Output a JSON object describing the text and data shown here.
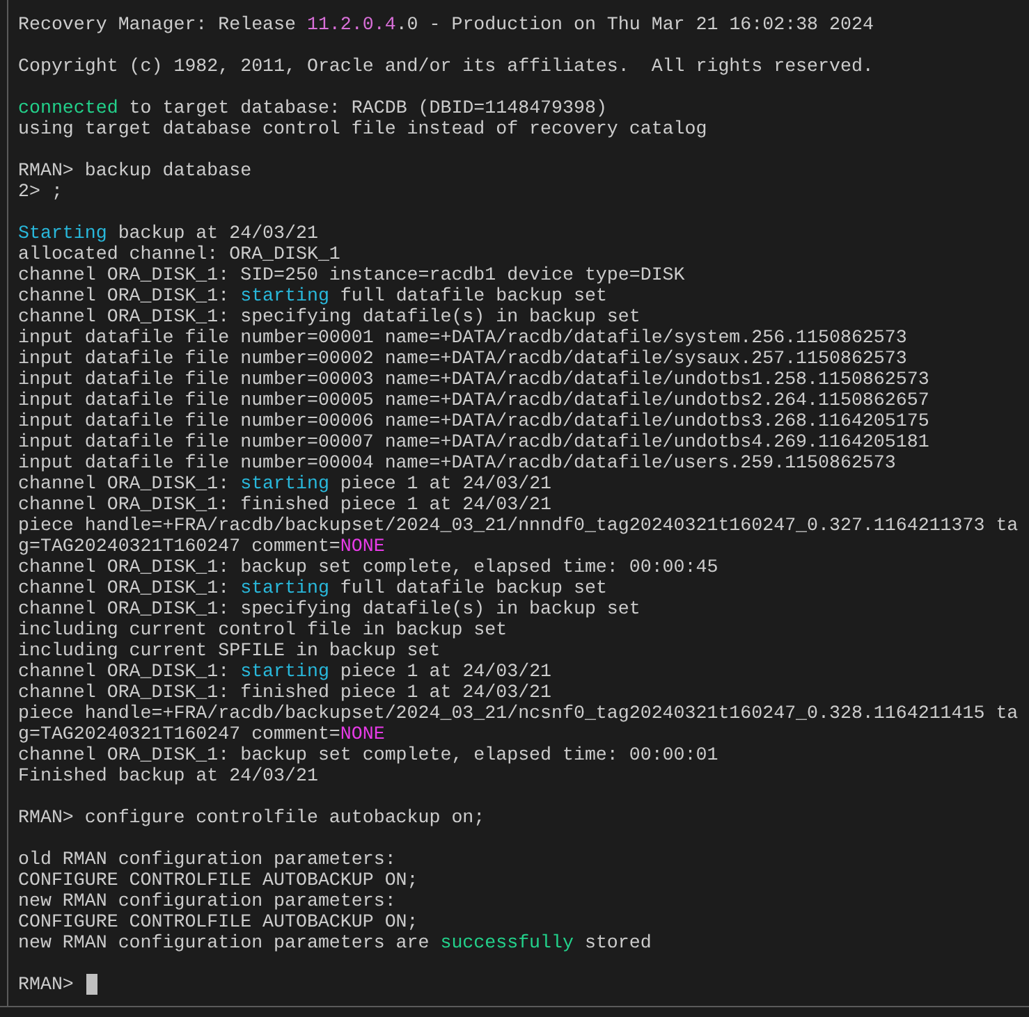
{
  "terminal": {
    "blocks": [
      [
        [
          {
            "text": "Recovery Manager: Release "
          },
          {
            "text": "11.2.0.4",
            "color": "#d86fd8"
          },
          {
            "text": ".0 - Production on Thu Mar 21 16:02:38 2024"
          }
        ]
      ],
      [
        [
          {
            "text": "Copyright (c) 1982, 2011, Oracle and/or its affiliates.  All rights reserved."
          }
        ]
      ],
      [
        [
          {
            "text": "connected",
            "color": "#23d18b"
          },
          {
            "text": " to target database: RACDB (DBID=1148479398)"
          }
        ],
        [
          {
            "text": "using target database control file instead of recovery catalog"
          }
        ]
      ],
      [
        [
          {
            "text": "RMAN> backup database"
          }
        ],
        [
          {
            "text": "2> ;"
          }
        ]
      ],
      [
        [
          {
            "text": "Starting",
            "color": "#29b8db"
          },
          {
            "text": " backup at 24/03/21"
          }
        ],
        [
          {
            "text": "allocated channel: ORA_DISK_1"
          }
        ],
        [
          {
            "text": "channel ORA_DISK_1: SID=250 instance=racdb1 device type=DISK"
          }
        ],
        [
          {
            "text": "channel ORA_DISK_1: "
          },
          {
            "text": "starting",
            "color": "#29b8db"
          },
          {
            "text": " full datafile backup set"
          }
        ],
        [
          {
            "text": "channel ORA_DISK_1: specifying datafile(s) in backup set"
          }
        ],
        [
          {
            "text": "input datafile file number=00001 name=+DATA/racdb/datafile/system.256.1150862573"
          }
        ],
        [
          {
            "text": "input datafile file number=00002 name=+DATA/racdb/datafile/sysaux.257.1150862573"
          }
        ],
        [
          {
            "text": "input datafile file number=00003 name=+DATA/racdb/datafile/undotbs1.258.1150862573"
          }
        ],
        [
          {
            "text": "input datafile file number=00005 name=+DATA/racdb/datafile/undotbs2.264.1150862657"
          }
        ],
        [
          {
            "text": "input datafile file number=00006 name=+DATA/racdb/datafile/undotbs3.268.1164205175"
          }
        ],
        [
          {
            "text": "input datafile file number=00007 name=+DATA/racdb/datafile/undotbs4.269.1164205181"
          }
        ],
        [
          {
            "text": "input datafile file number=00004 name=+DATA/racdb/datafile/users.259.1150862573"
          }
        ],
        [
          {
            "text": "channel ORA_DISK_1: "
          },
          {
            "text": "starting",
            "color": "#29b8db"
          },
          {
            "text": " piece 1 at 24/03/21"
          }
        ],
        [
          {
            "text": "channel ORA_DISK_1: finished piece 1 at 24/03/21"
          }
        ],
        [
          {
            "text": "piece handle=+FRA/racdb/backupset/2024_03_21/nnndf0_tag20240321t160247_0.327.1164211373 ta"
          }
        ],
        [
          {
            "text": "g=TAG20240321T160247 comment="
          },
          {
            "text": "NONE",
            "color": "#e73be7"
          }
        ],
        [
          {
            "text": "channel ORA_DISK_1: backup set complete, elapsed time: 00:00:45"
          }
        ],
        [
          {
            "text": "channel ORA_DISK_1: "
          },
          {
            "text": "starting",
            "color": "#29b8db"
          },
          {
            "text": " full datafile backup set"
          }
        ],
        [
          {
            "text": "channel ORA_DISK_1: specifying datafile(s) in backup set"
          }
        ],
        [
          {
            "text": "including current control file in backup set"
          }
        ],
        [
          {
            "text": "including current SPFILE in backup set"
          }
        ],
        [
          {
            "text": "channel ORA_DISK_1: "
          },
          {
            "text": "starting",
            "color": "#29b8db"
          },
          {
            "text": " piece 1 at 24/03/21"
          }
        ],
        [
          {
            "text": "channel ORA_DISK_1: finished piece 1 at 24/03/21"
          }
        ],
        [
          {
            "text": "piece handle=+FRA/racdb/backupset/2024_03_21/ncsnf0_tag20240321t160247_0.328.1164211415 ta"
          }
        ],
        [
          {
            "text": "g=TAG20240321T160247 comment="
          },
          {
            "text": "NONE",
            "color": "#e73be7"
          }
        ],
        [
          {
            "text": "channel ORA_DISK_1: backup set complete, elapsed time: 00:00:01"
          }
        ],
        [
          {
            "text": "Finished backup at 24/03/21"
          }
        ]
      ],
      [
        [
          {
            "text": "RMAN> configure controlfile autobackup on;"
          }
        ]
      ],
      [
        [
          {
            "text": "old RMAN configuration parameters:"
          }
        ],
        [
          {
            "text": "CONFIGURE CONTROLFILE AUTOBACKUP ON;"
          }
        ],
        [
          {
            "text": "new RMAN configuration parameters:"
          }
        ],
        [
          {
            "text": "CONFIGURE CONTROLFILE AUTOBACKUP ON;"
          }
        ],
        [
          {
            "text": "new RMAN configuration parameters are "
          },
          {
            "text": "successfully",
            "color": "#23d18b"
          },
          {
            "text": " stored"
          }
        ]
      ],
      [
        [
          {
            "text": "RMAN>"
          }
        ]
      ]
    ],
    "cursor": true
  }
}
